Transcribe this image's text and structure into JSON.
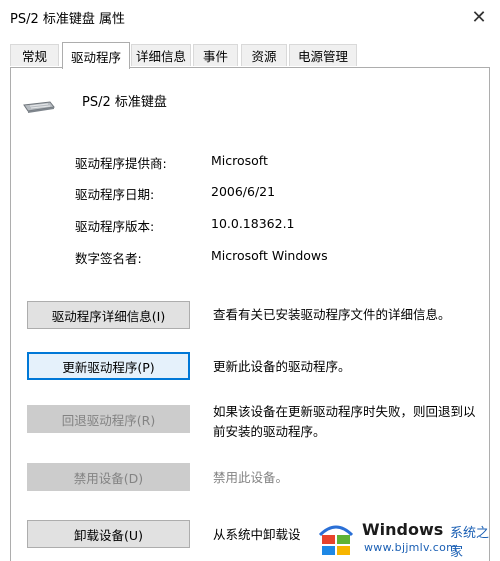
{
  "window": {
    "title": "PS/2 标准键盘 属性",
    "close_glyph": "✕"
  },
  "tabs": [
    {
      "label": "常规"
    },
    {
      "label": "驱动程序",
      "active": true
    },
    {
      "label": "详细信息"
    },
    {
      "label": "事件"
    },
    {
      "label": "资源"
    },
    {
      "label": "电源管理"
    }
  ],
  "device": {
    "name": "PS/2 标准键盘",
    "icon": "keyboard-icon"
  },
  "info": [
    {
      "label": "驱动程序提供商:",
      "value": "Microsoft"
    },
    {
      "label": "驱动程序日期:",
      "value": "2006/6/21"
    },
    {
      "label": "驱动程序版本:",
      "value": "10.0.18362.1"
    },
    {
      "label": "数字签名者:",
      "value": "Microsoft Windows"
    }
  ],
  "actions": [
    {
      "label": "驱动程序详细信息(I)",
      "desc": "查看有关已安装驱动程序文件的详细信息。",
      "state": "normal"
    },
    {
      "label": "更新驱动程序(P)",
      "desc": "更新此设备的驱动程序。",
      "state": "focused"
    },
    {
      "label": "回退驱动程序(R)",
      "desc": "如果该设备在更新驱动程序时失败，则回退到以前安装的驱动程序。",
      "state": "disabled"
    },
    {
      "label": "禁用设备(D)",
      "desc": "禁用此设备。",
      "state": "disabled"
    },
    {
      "label": "卸载设备(U)",
      "desc": "从系统中卸载设",
      "state": "normal"
    }
  ],
  "watermark": {
    "brand": "Windows",
    "cn": "系统之家",
    "url": "www.bjjmlv.com"
  }
}
